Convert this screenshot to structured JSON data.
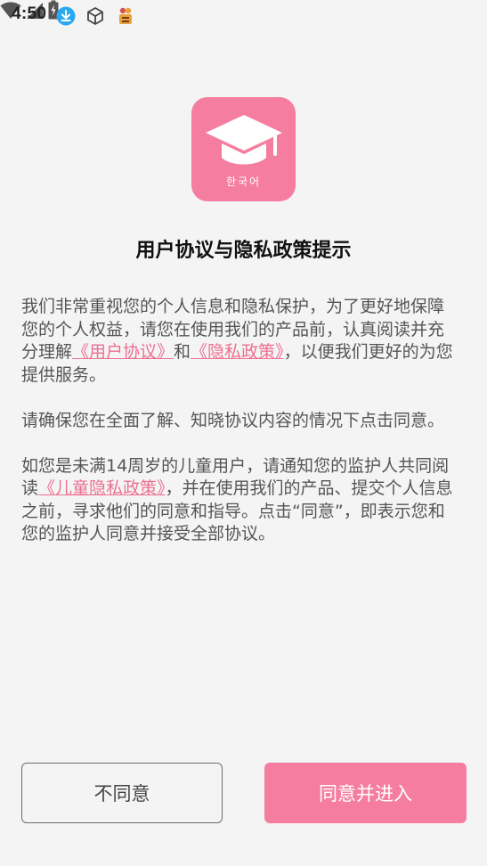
{
  "status_bar": {
    "time": "4:50",
    "icons": [
      "download-icon",
      "cube-icon",
      "app-notification-icon",
      "wifi-icon",
      "signal-icon",
      "battery-icon"
    ]
  },
  "logo": {
    "text": "한국어",
    "icon": "graduation-cap-icon",
    "color": "#f57ea0"
  },
  "title": "用户协议与隐私政策提示",
  "paragraph1": {
    "text_a": "我们非常重视您的个人信息和隐私保护，为了更好地保障您的个人权益，请您在使用我们的产品前，认真阅读并充分理解",
    "link_user_agreement": "《用户协议》",
    "text_b": "和",
    "link_privacy_policy": "《隐私政策》",
    "text_c": "，以便我们更好的为您提供服务。"
  },
  "paragraph2": {
    "text": "请确保您在全面了解、知晓协议内容的情况下点击同意。"
  },
  "paragraph3": {
    "text_a": "如您是未满14周岁的儿童用户，请通知您的监护人共同阅读",
    "link_child_privacy": "《儿童隐私政策》",
    "text_b": "，并在使用我们的产品、提交个人信息之前，寻求他们的同意和指导。点击“同意”，即表示您和您的监护人同意并接受全部协议。"
  },
  "buttons": {
    "disagree_label": "不同意",
    "agree_label": "同意并进入"
  },
  "colors": {
    "accent": "#f57ea0",
    "link": "#ec6f93",
    "background": "#f5f4f5"
  }
}
